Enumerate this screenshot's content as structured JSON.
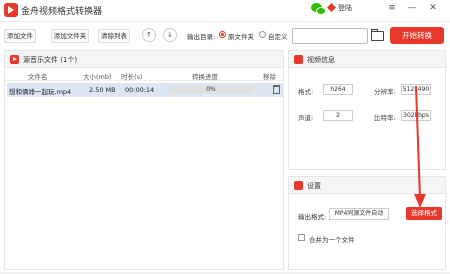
{
  "app": {
    "title": "金舟视频格式转换器",
    "login_label": "登陆"
  },
  "window": {
    "menu_glyph": "≡",
    "minimize_glyph": "—",
    "close_glyph": "✕"
  },
  "toolbar": {
    "add_file": "添加文件",
    "add_folder": "添加文件夹",
    "clear_list": "清除列表",
    "move_up": "↑",
    "move_down": "↓",
    "output_dir_label": "输出目录:",
    "option_source": "原文件夹",
    "option_custom": "自定义",
    "selected_option": "原文件夹",
    "output_path_value": "",
    "start_button": "开始转换"
  },
  "file_panel": {
    "title": "源音乐文件 (1个)",
    "columns": [
      "文件名",
      "大小(mb)",
      "时长(s)",
      "转换进度",
      "移除"
    ],
    "rows": [
      {
        "name": "想和俩竫一起玩.mp4",
        "size": "2.50 MB",
        "duration": "00:00:14",
        "progress_text": "0%",
        "progress": 0
      }
    ]
  },
  "video_info": {
    "title": "视频信息",
    "format_label": "格式:",
    "format_value": "h264",
    "resolution_label": "分辨率:",
    "resolution_value": "512x490",
    "channels_label": "声道:",
    "channels_value": "2",
    "bitrate_label": "比特率:",
    "bitrate_value": "302kbps"
  },
  "settings": {
    "title": "设置",
    "output_format_label": "输出格式:",
    "output_format_value": "MP4同源文件自动",
    "choose_format_button": "选择格式",
    "merge_label": "合并为一个文件",
    "merge_checked": false
  },
  "colors": {
    "accent": "#e8382c",
    "row_selected": "#dce6f5"
  },
  "icons": [
    "app-logo-icon",
    "wechat-icon",
    "vip-icon",
    "folder-icon",
    "trash-icon",
    "video-info-icon",
    "settings-icon"
  ]
}
